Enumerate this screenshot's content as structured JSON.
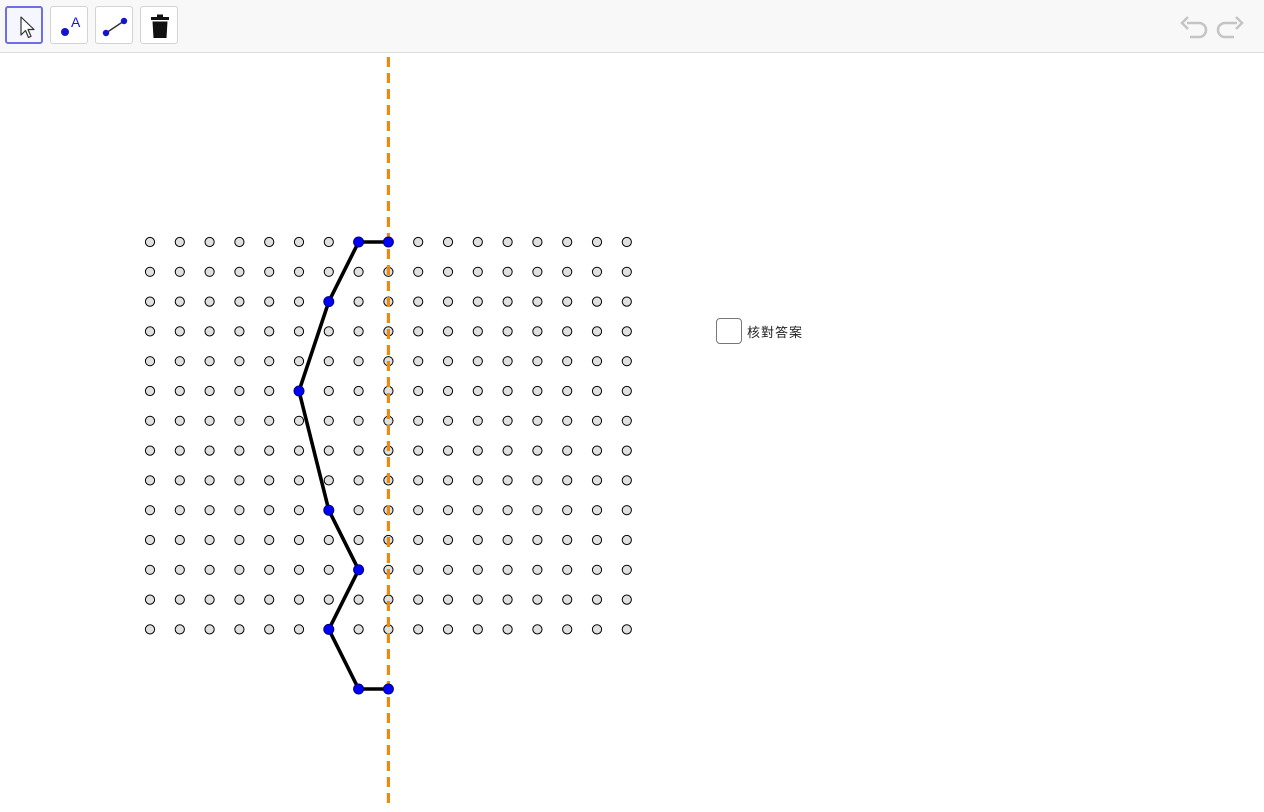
{
  "toolbar": {
    "tools": [
      {
        "name": "move-tool",
        "icon": "cursor-arrow-icon",
        "selected": true
      },
      {
        "name": "point-tool",
        "icon": "point-icon",
        "label": "A"
      },
      {
        "name": "segment-tool",
        "icon": "segment-icon"
      },
      {
        "name": "delete-tool",
        "icon": "trash-icon"
      }
    ],
    "undo_icon": "undo-icon",
    "redo_icon": "redo-icon"
  },
  "grid": {
    "columns": 17,
    "rows": 14,
    "dot_color": "#e0e0e0",
    "dot_outline": "#000000"
  },
  "polyline": {
    "color": "#000000",
    "vertex_color": "#0000ff",
    "vertices": [
      [
        8,
        0
      ],
      [
        7,
        0
      ],
      [
        6,
        2
      ],
      [
        5,
        5
      ],
      [
        6,
        9
      ],
      [
        7,
        11
      ],
      [
        6,
        13
      ],
      [
        7,
        15
      ],
      [
        8,
        15
      ]
    ]
  },
  "symmetry_axis": {
    "column": 8,
    "color": "#e68a1a",
    "style": "dashed"
  },
  "check": {
    "label": "核對答案",
    "checked": false
  }
}
